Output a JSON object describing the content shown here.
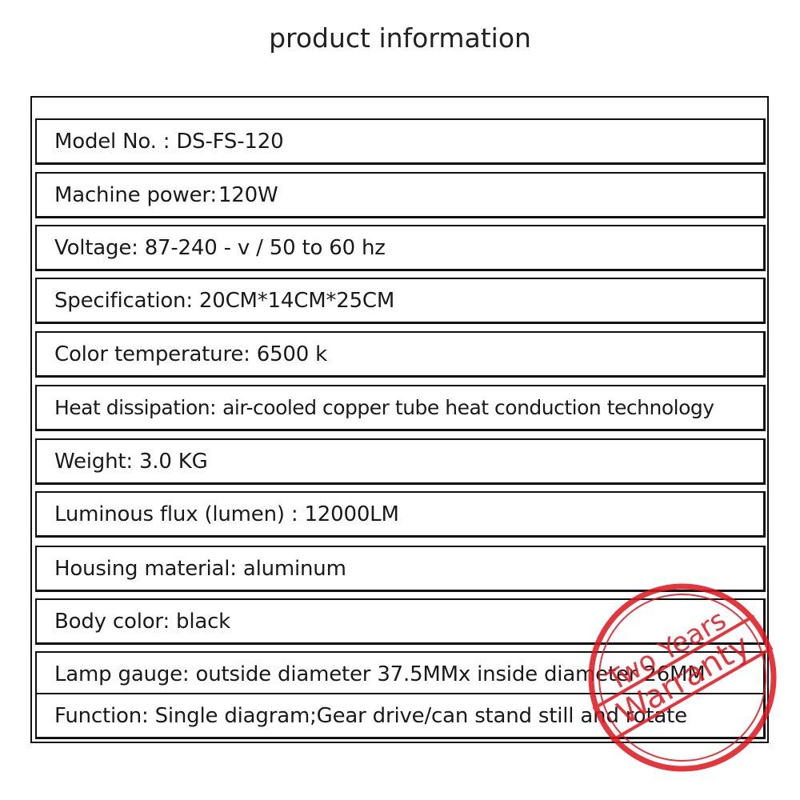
{
  "title": "product information",
  "rows": [
    {
      "label": "Model No. :",
      "value": "DS-FS-120"
    },
    {
      "label": "Machine power:",
      "value": "120W"
    },
    {
      "label": "Voltage:",
      "value": "87-240 - v / 50 to 60 hz"
    },
    {
      "label": "Specification:",
      "value": "20CM*14CM*25CM"
    },
    {
      "label": "Color temperature:",
      "value": "6500 k"
    },
    {
      "label": "Heat dissipation:",
      "value": "air-cooled copper tube heat conduction technology"
    },
    {
      "label": "Weight:",
      "value": "3.0 KG"
    },
    {
      "label": "Luminous flux (lumen) :",
      "value": "12000LM"
    },
    {
      "label": "Housing material:",
      "value": "aluminum"
    },
    {
      "label": "Body color:",
      "value": "black"
    },
    {
      "label": "Lamp gauge:",
      "value": "outside diameter 37.5MMx inside diameter 26MM"
    },
    {
      "label": "Function:",
      "value": "Single diagram;Gear drive/can stand still and rotate"
    }
  ],
  "stamp": {
    "line1": "Two Years",
    "line2": "Warranty",
    "color": "#e0141c"
  }
}
